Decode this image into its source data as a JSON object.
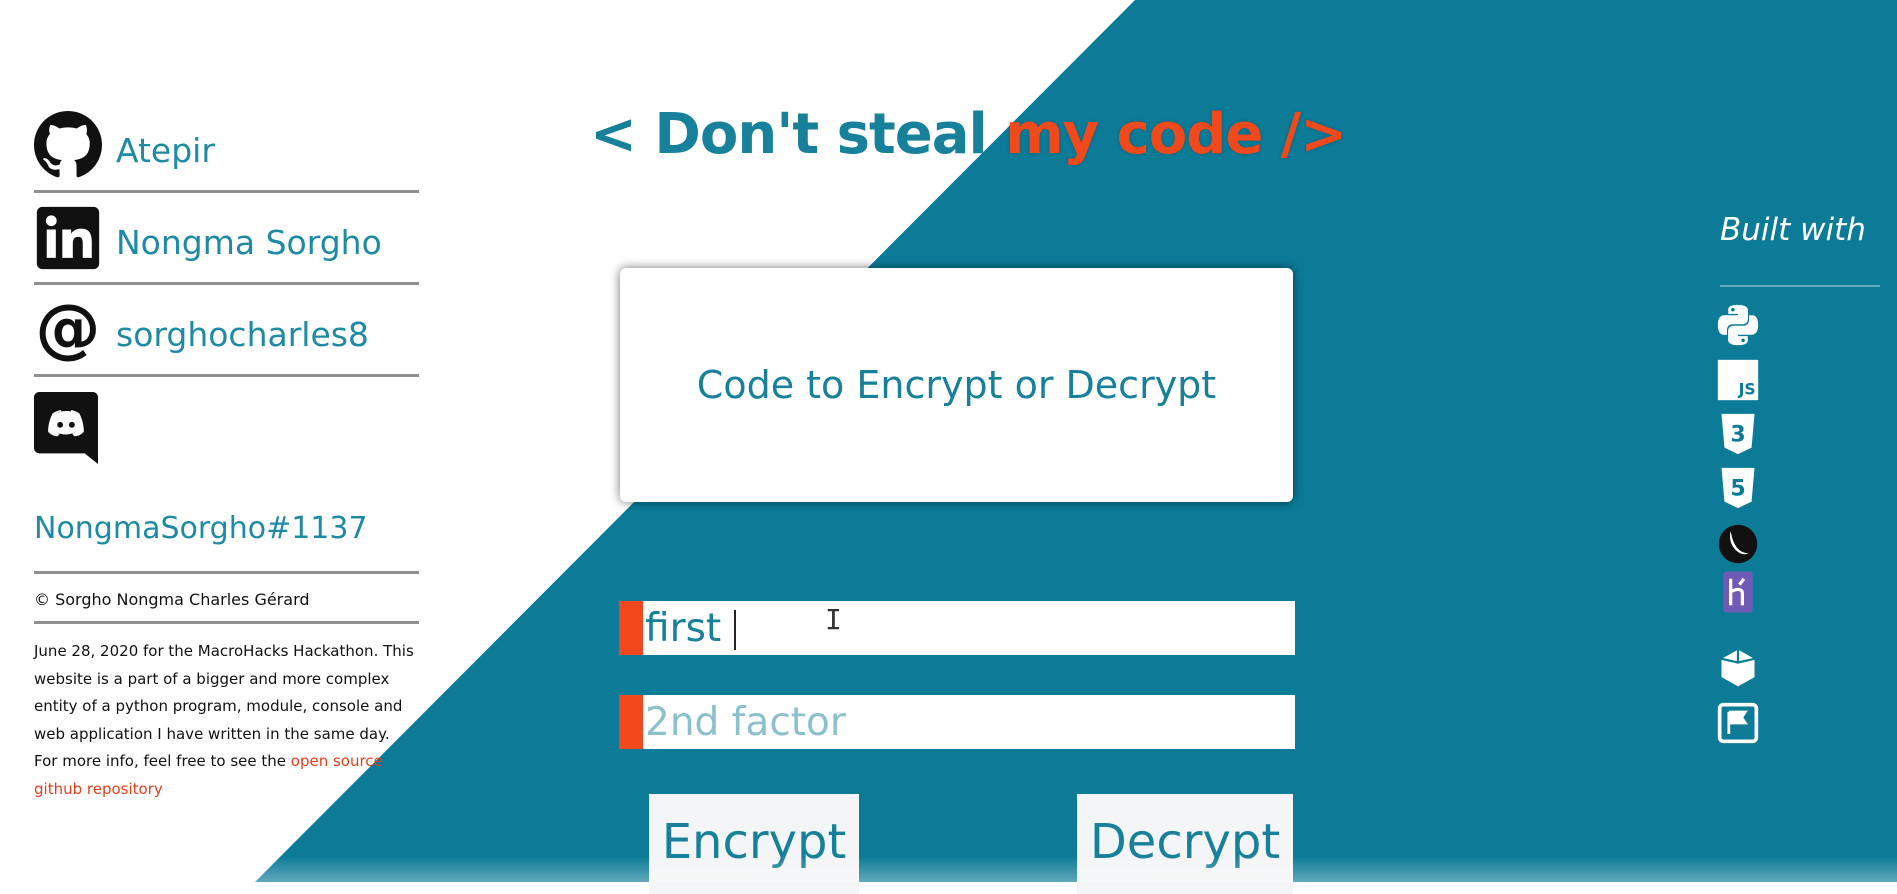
{
  "headline": {
    "part1": "< Don't steal ",
    "part2": "my code />"
  },
  "contacts": [
    {
      "icon": "github-icon",
      "label": "Atepir"
    },
    {
      "icon": "linkedin-icon",
      "label": "Nongma Sorgho"
    },
    {
      "icon": "at-sign-icon",
      "label": "sorghocharles8"
    },
    {
      "icon": "discord-icon",
      "label": "NongmaSorgho#1137"
    }
  ],
  "footer": {
    "copyright": "© Sorgho Nongma Charles Gérard",
    "about_text": "June 28, 2020 for the MacroHacks Hackathon. This website is a part of a bigger and more complex entity of a python program, module, console and web application I have written in the same day. For more info, feel free to see the ",
    "about_link": "open source github repository"
  },
  "card": {
    "text": "Code to Encrypt or Decrypt"
  },
  "inputs": {
    "first_value": "first",
    "second_placeholder": "2nd factor"
  },
  "buttons": {
    "encrypt": "Encrypt",
    "decrypt": "Decrypt"
  },
  "built_with": {
    "title": "Built with",
    "tech_icons": [
      "python-icon",
      "javascript-icon",
      "css3-icon",
      "html5-icon",
      "flask-icon",
      "heroku-icon",
      "codepen-icon",
      "brackets-icon"
    ]
  },
  "colors": {
    "teal": "#0b7b98",
    "accent": "#f04a1c",
    "text_teal": "#17809a"
  }
}
